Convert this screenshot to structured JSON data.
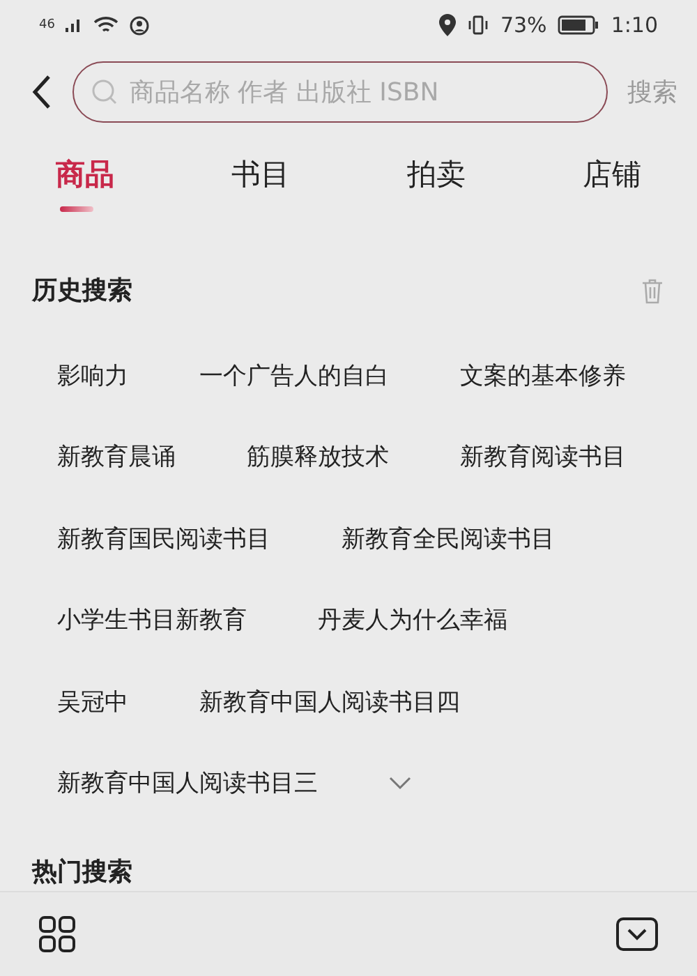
{
  "status_bar": {
    "network": "46",
    "battery": "73%",
    "time": "1:10"
  },
  "search": {
    "placeholder": "商品名称 作者 出版社 ISBN",
    "button": "搜索"
  },
  "tabs": [
    {
      "label": "商品",
      "selected": true
    },
    {
      "label": "书目",
      "selected": false
    },
    {
      "label": "拍卖",
      "selected": false
    },
    {
      "label": "店铺",
      "selected": false
    }
  ],
  "history": {
    "title": "历史搜索",
    "rows": [
      [
        "影响力",
        "一个广告人的自白",
        "文案的基本修养"
      ],
      [
        "新教育晨诵",
        "筋膜释放技术",
        "新教育阅读书目"
      ],
      [
        "新教育国民阅读书目",
        "新教育全民阅读书目"
      ],
      [
        "小学生书目新教育",
        "丹麦人为什么幸福"
      ],
      [
        "吴冠中",
        "新教育中国人阅读书目四"
      ],
      [
        "新教育中国人阅读书目三"
      ]
    ],
    "expanded": false
  },
  "hot": {
    "title": "热门搜索"
  }
}
